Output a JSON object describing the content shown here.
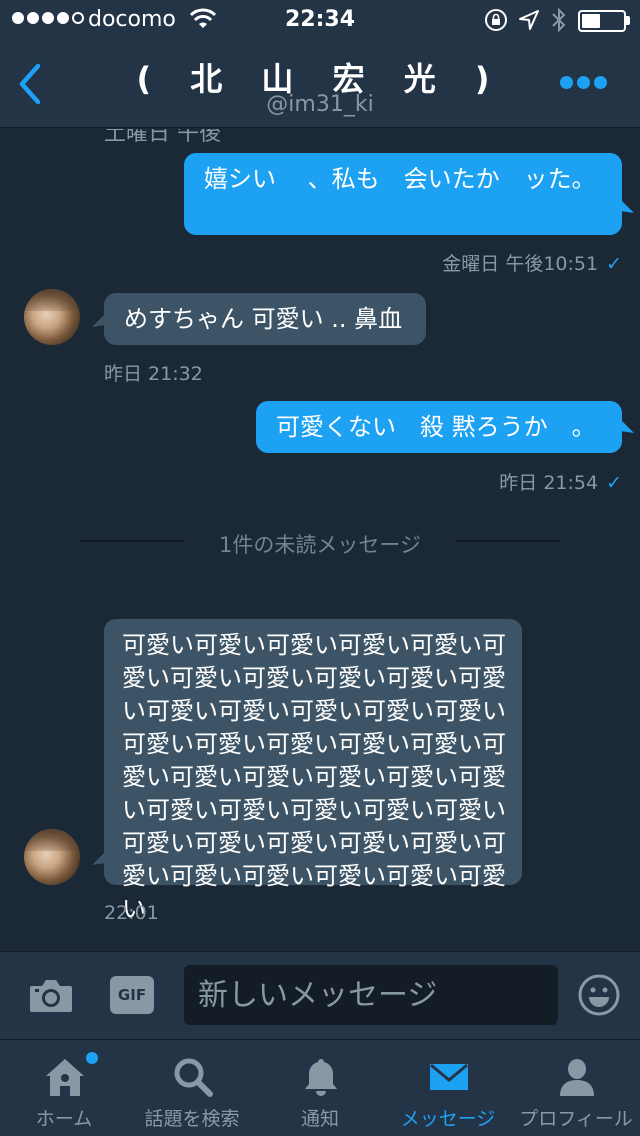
{
  "status_bar": {
    "carrier": "docomo",
    "time": "22:34",
    "battery_level": 0.45,
    "signal_bars": 4
  },
  "header": {
    "title": "( 北 山 宏 光 )",
    "handle": "@im31_ki",
    "back_icon": "chevron-left-icon",
    "more_icon": "more-dots-icon"
  },
  "conversation": {
    "cut_off_timestamp": "土曜日 午後",
    "messages": [
      {
        "direction": "out",
        "text": "嬉シい　 、私も　会いたか　ッた。",
        "timestamp": "金曜日 午後10:51",
        "read": "✓"
      },
      {
        "direction": "in",
        "text": "めすちゃん  可愛い  .. 鼻血",
        "timestamp": "昨日 21:32"
      },
      {
        "direction": "out",
        "text": "可愛くない　殺  黙ろうか　。",
        "timestamp": "昨日 21:54",
        "read": "✓"
      },
      {
        "direction": "in",
        "text": "可愛い可愛い可愛い可愛い可愛い可愛い可愛い可愛い可愛い可愛い可愛い可愛い可愛い可愛い可愛い可愛い可愛い可愛い可愛い可愛い可愛い可愛い可愛い可愛い可愛い可愛い可愛い可愛い可愛い可愛い可愛い可愛い可愛い可愛い可愛い可愛い可愛い可愛い可愛い可愛い可愛い可愛い可愛い",
        "timestamp": "22:01"
      }
    ],
    "unread_divider": "1件の未読メッセージ"
  },
  "composer": {
    "placeholder": "新しいメッセージ",
    "camera_icon": "camera-icon",
    "gif_label": "GIF",
    "emoji_icon": "emoji-icon"
  },
  "tabs": [
    {
      "label": "ホーム",
      "icon": "home-icon",
      "active": false,
      "badge": true
    },
    {
      "label": "話題を検索",
      "icon": "search-icon",
      "active": false
    },
    {
      "label": "通知",
      "icon": "bell-icon",
      "active": false
    },
    {
      "label": "メッセージ",
      "icon": "envelope-icon",
      "active": true
    },
    {
      "label": "プロフィール",
      "icon": "person-icon",
      "active": false
    }
  ],
  "colors": {
    "background": "#1b2836",
    "bar": "#243447",
    "accent": "#1da1f2",
    "incoming_bubble": "#3d5466",
    "muted_text": "#8899a6"
  }
}
